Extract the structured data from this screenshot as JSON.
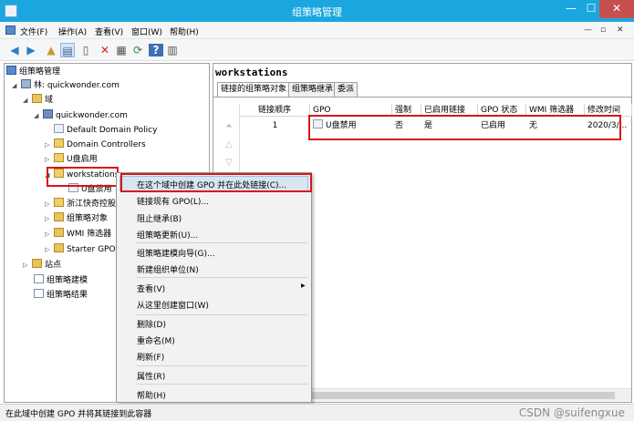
{
  "window": {
    "title": "组策略管理",
    "minimize": "—",
    "maximize": "☐",
    "close": "✕"
  },
  "menu": [
    "文件(F)",
    "操作(A)",
    "查看(V)",
    "窗口(W)",
    "帮助(H)"
  ],
  "mdi_controls": [
    "—",
    "▫",
    "✕"
  ],
  "toolbar": [
    "back-icon",
    "forward-icon",
    "up-folder-icon",
    "show-tree-icon",
    "copy-icon",
    "delete-icon",
    "properties-icon",
    "refresh-icon",
    "help-icon",
    "view-icon"
  ],
  "tree": {
    "root": "组策略管理",
    "forest": "林: quickwonder.com",
    "domains": "域",
    "domain": "quickwonder.com",
    "items": [
      "Default Domain Policy",
      "Domain Controllers",
      "U盘启用",
      "workstations",
      "U盘禁用",
      "浙江快奇控股",
      "组策略对象",
      "WMI 筛选器",
      "Starter GPO"
    ],
    "sites": "站点",
    "modeling": "组策略建模",
    "results": "组策略结果"
  },
  "right": {
    "title": "workstations",
    "tabs": [
      "链接的组策略对象",
      "组策略继承",
      "委派"
    ],
    "columns": [
      "链接顺序",
      "GPO",
      "强制",
      "已启用链接",
      "GPO 状态",
      "WMI 筛选器",
      "修改时间"
    ],
    "rows": [
      {
        "order": "1",
        "gpo": "U盘禁用",
        "enforced": "否",
        "link_enabled": "是",
        "status": "已启用",
        "wmi": "无",
        "modified": "2020/3/..."
      }
    ]
  },
  "context_menu": {
    "items": [
      "在这个域中创建 GPO 并在此处链接(C)...",
      "链接现有 GPO(L)...",
      "阻止继承(B)",
      "组策略更新(U)...",
      "组策略建模向导(G)...",
      "新建组织单位(N)",
      "查看(V)",
      "从这里创建窗口(W)",
      "删除(D)",
      "重命名(M)",
      "刷新(F)",
      "属性(R)",
      "帮助(H)"
    ],
    "submenu_arrow": "▶"
  },
  "status": {
    "text": "在此域中创建 GPO 并将其链接到此容器",
    "watermark": "CSDN @suifengxue"
  },
  "colors": {
    "titlebar": "#1aa7df",
    "highlight": "#d9141b",
    "close": "#c7504f"
  }
}
